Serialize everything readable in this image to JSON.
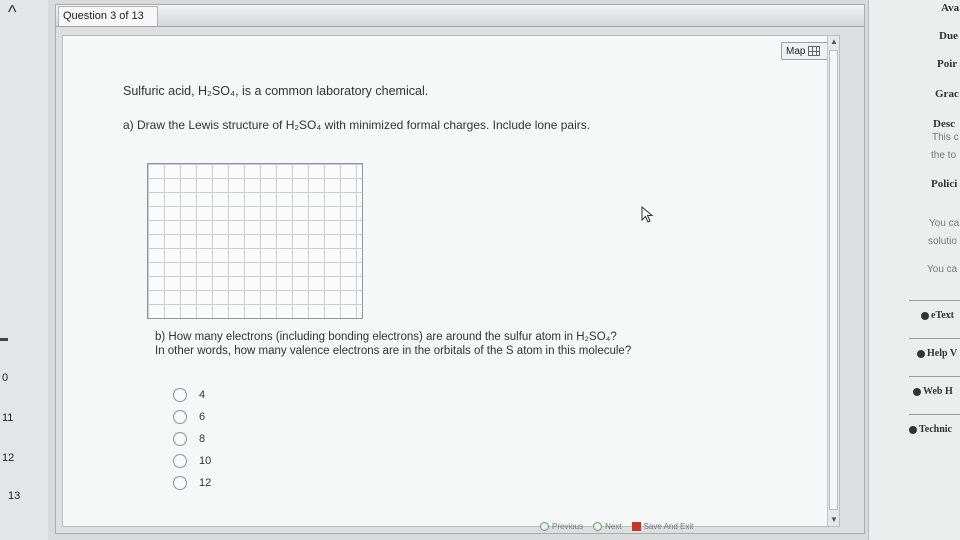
{
  "left_nav": {
    "up_icon": "chevron-up-icon",
    "questions": [
      "0",
      "11",
      "12",
      "13"
    ]
  },
  "window": {
    "tab_label": "Question 3 of 13",
    "map_label": "Map"
  },
  "question": {
    "intro": "Sulfuric acid, H₂SO₄, is a common laboratory chemical.",
    "part_a": "a) Draw the Lewis structure of H₂SO₄ with minimized formal charges. Include lone pairs.",
    "part_b_line1": "b) How many electrons (including bonding electrons) are around the sulfur atom in H₂SO₄?",
    "part_b_line2": "In other words, how many valence electrons are in the orbitals of the S atom in this molecule?",
    "options": [
      "4",
      "6",
      "8",
      "10",
      "12"
    ]
  },
  "footer": {
    "previous": "Previous",
    "next": "Next",
    "save_exit": "Save And Exit"
  },
  "right_panel": {
    "available": "Ava",
    "due": "Due",
    "points": "Poir",
    "grade": "Grac",
    "description": "Desc",
    "desc_line1": "This c",
    "desc_line2": "the to",
    "policies": "Polici",
    "policy_line1": "You ca",
    "policy_line2": "solutio",
    "policy_line3": "You ca",
    "etext": "eText",
    "help": "Help V",
    "web": "Web H",
    "technical": "Technic"
  }
}
